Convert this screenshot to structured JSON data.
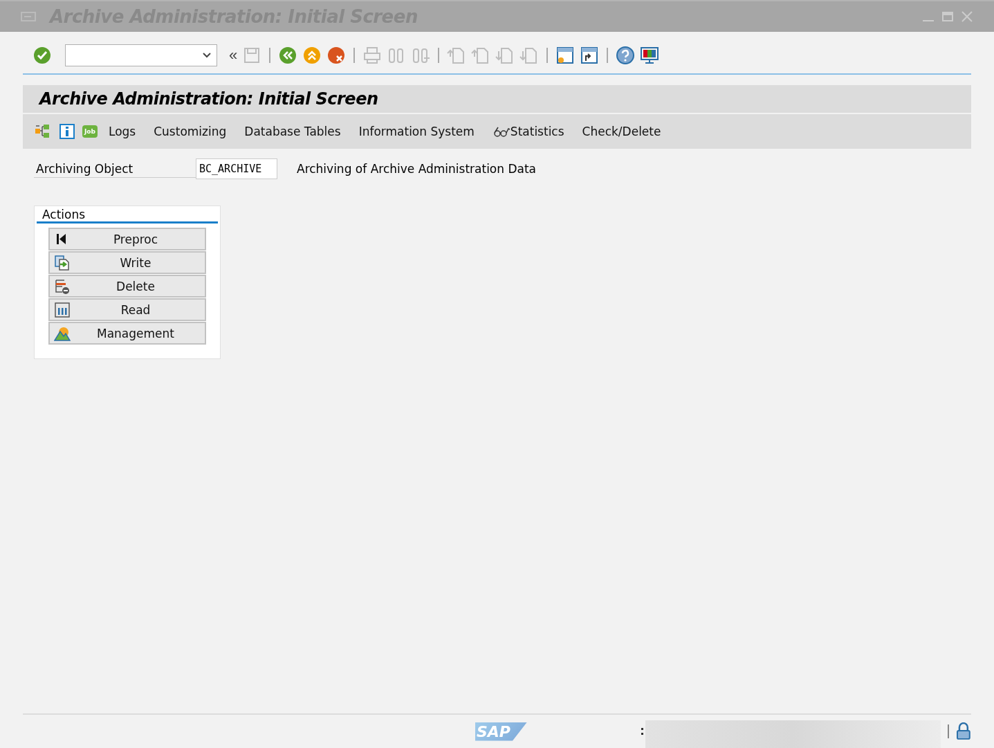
{
  "window": {
    "title": "Archive Administration: Initial Screen"
  },
  "toolbar": {
    "items": [
      {
        "kind": "enter",
        "disabled": false
      },
      {
        "kind": "field"
      },
      {
        "kind": "collapse",
        "text": "«",
        "disabled": false
      },
      {
        "kind": "save",
        "disabled": true
      },
      {
        "kind": "sep"
      },
      {
        "kind": "back",
        "disabled": false
      },
      {
        "kind": "exit",
        "disabled": false
      },
      {
        "kind": "cancel",
        "disabled": false
      },
      {
        "kind": "sep"
      },
      {
        "kind": "print",
        "disabled": true
      },
      {
        "kind": "find",
        "disabled": true
      },
      {
        "kind": "find-next",
        "disabled": true
      },
      {
        "kind": "sep"
      },
      {
        "kind": "first-page",
        "disabled": true
      },
      {
        "kind": "prev-page",
        "disabled": true
      },
      {
        "kind": "next-page",
        "disabled": true
      },
      {
        "kind": "last-page",
        "disabled": true
      },
      {
        "kind": "sep"
      },
      {
        "kind": "new-session",
        "disabled": false
      },
      {
        "kind": "shortcut",
        "disabled": false
      },
      {
        "kind": "sep"
      },
      {
        "kind": "help",
        "disabled": false
      },
      {
        "kind": "layout",
        "disabled": false
      }
    ]
  },
  "screen": {
    "title": "Archive Administration: Initial Screen",
    "app_toolbar": [
      {
        "kind": "tree"
      },
      {
        "kind": "info"
      },
      {
        "kind": "job",
        "text": "Job"
      },
      {
        "kind": "text",
        "label": "Logs"
      },
      {
        "kind": "text",
        "label": "Customizing"
      },
      {
        "kind": "text",
        "label": "Database Tables"
      },
      {
        "kind": "text",
        "label": "Information System"
      },
      {
        "kind": "glasses-text",
        "label": "Statistics"
      },
      {
        "kind": "text",
        "label": "Check/Delete"
      }
    ],
    "archiving_object": {
      "label": "Archiving Object",
      "value": "BC_ARCHIVE",
      "description": "Archiving of Archive Administration Data"
    },
    "actions": {
      "title": "Actions",
      "buttons": [
        {
          "label": "Preproc",
          "kind": "first"
        },
        {
          "label": "Write",
          "kind": "write"
        },
        {
          "label": "Delete",
          "kind": "delete"
        },
        {
          "label": "Read",
          "kind": "read"
        },
        {
          "label": "Management",
          "kind": "mountain"
        }
      ]
    }
  },
  "status_bar": {
    "logo": "SAP"
  }
}
